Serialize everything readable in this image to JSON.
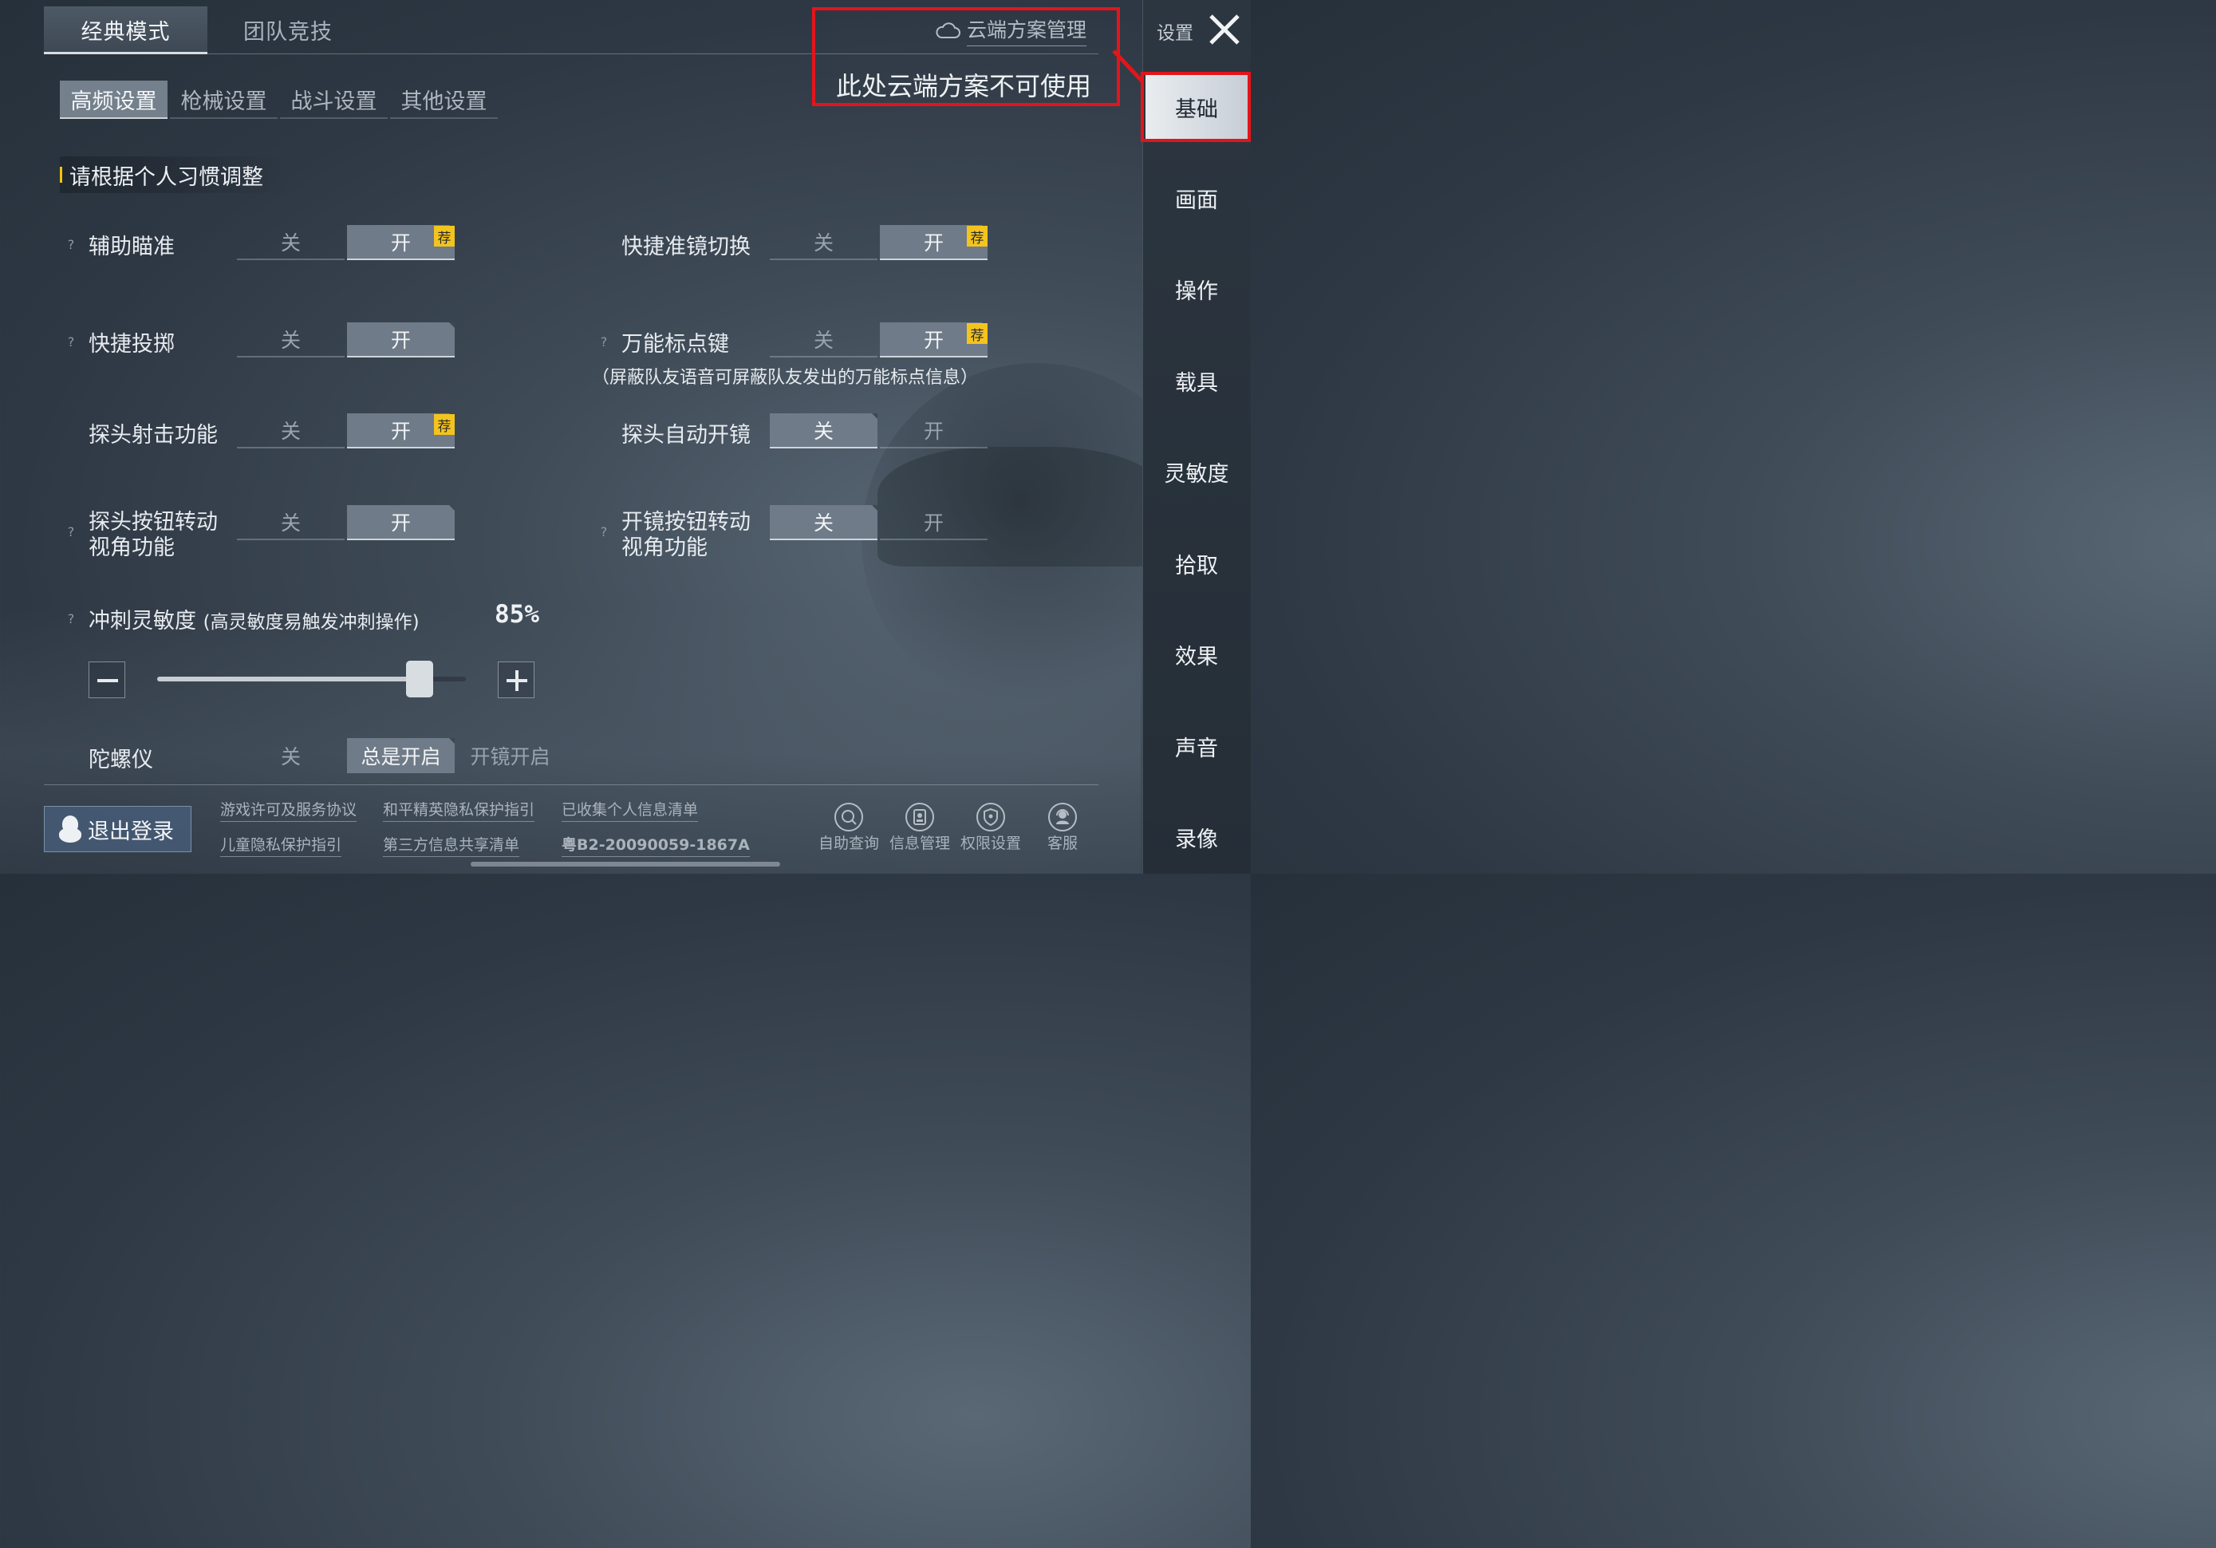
{
  "top_tabs": [
    {
      "label": "经典模式",
      "active": true
    },
    {
      "label": "团队竞技",
      "active": false
    }
  ],
  "sub_tabs": [
    {
      "label": "高频设置",
      "active": true
    },
    {
      "label": "枪械设置",
      "active": false
    },
    {
      "label": "战斗设置",
      "active": false
    },
    {
      "label": "其他设置",
      "active": false
    }
  ],
  "section_title": "请根据个人习惯调整",
  "common": {
    "off": "关",
    "on": "开",
    "recommend": "荐",
    "help": "?"
  },
  "settings": {
    "aim_assist": {
      "label": "辅助瞄准",
      "value": "开",
      "recommended": true
    },
    "quick_scope_switch": {
      "label": "快捷准镜切换",
      "value": "开",
      "recommended": true
    },
    "quick_throw": {
      "label": "快捷投掷",
      "value": "开",
      "recommended": false
    },
    "universal_marker": {
      "label": "万能标点键",
      "value": "开",
      "recommended": true,
      "note": "（屏蔽队友语音可屏蔽队友发出的万能标点信息）"
    },
    "peek_shoot": {
      "label": "探头射击功能",
      "value": "开",
      "recommended": true
    },
    "peek_auto_scope": {
      "label": "探头自动开镜",
      "value": "关"
    },
    "peek_button_rotate": {
      "label_line1": "探头按钮转动",
      "label_line2": "视角功能",
      "value": "开"
    },
    "scope_button_rotate": {
      "label_line1": "开镜按钮转动",
      "label_line2": "视角功能",
      "value": "关"
    },
    "sprint_sensitivity": {
      "label": "冲刺灵敏度",
      "hint": "(高灵敏度易触发冲刺操作)",
      "value_text": "85%",
      "value": 0.85
    },
    "gyroscope": {
      "label": "陀螺仪",
      "options": [
        "关",
        "总是开启",
        "开镜开启"
      ],
      "selected": "总是开启"
    }
  },
  "cloud": {
    "link": "云端方案管理",
    "annotation": "此处云端方案不可使用"
  },
  "sidebar": {
    "title": "设置",
    "items": [
      "基础",
      "画面",
      "操作",
      "载具",
      "灵敏度",
      "拾取",
      "效果",
      "声音",
      "录像"
    ],
    "active": "基础"
  },
  "footer": {
    "logout": "退出登录",
    "links_row1": [
      "游戏许可及服务协议",
      "和平精英隐私保护指引",
      "已收集个人信息清单"
    ],
    "links_row2": [
      "儿童隐私保护指引",
      "第三方信息共享清单",
      "粤B2-20090059-1867A"
    ],
    "icons": [
      {
        "label": "自助查询",
        "icon": "search-icon"
      },
      {
        "label": "信息管理",
        "icon": "id-card-icon"
      },
      {
        "label": "权限设置",
        "icon": "shield-icon"
      },
      {
        "label": "客服",
        "icon": "support-agent-icon"
      }
    ]
  },
  "colors": {
    "highlight_box": "#e3151b",
    "recommend_badge": "#f3c41e",
    "section_marker": "#f1c40f"
  }
}
